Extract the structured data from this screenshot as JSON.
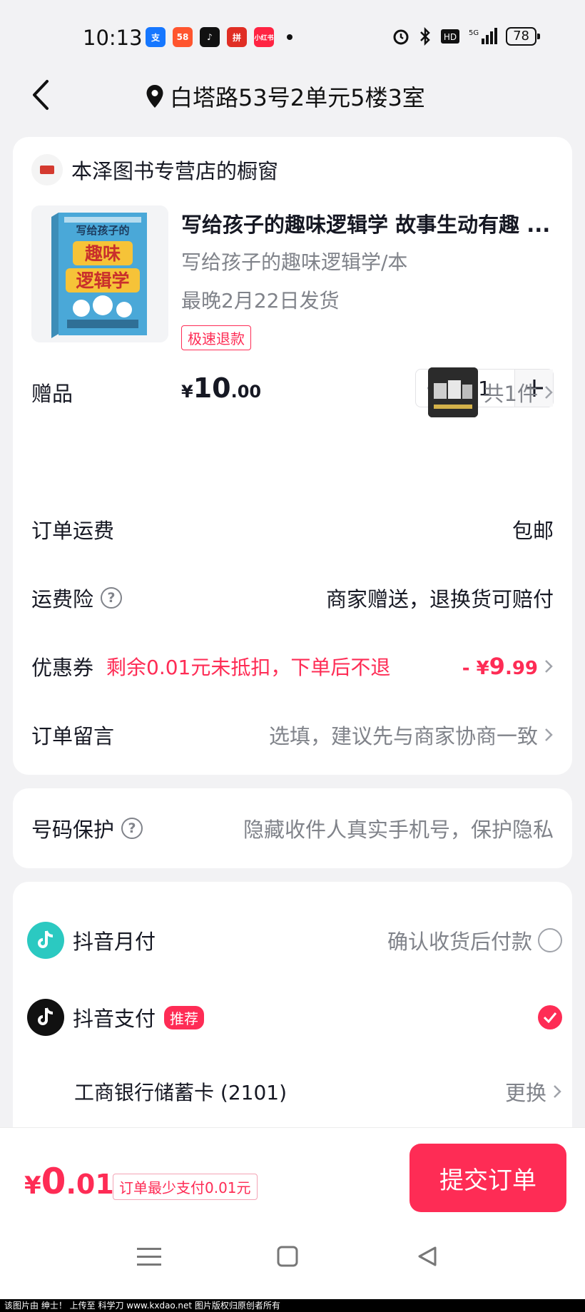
{
  "status_bar": {
    "time": "10:13",
    "battery": "78",
    "apps": [
      {
        "name": "alipay-icon",
        "text": "支",
        "color": "#1677ff"
      },
      {
        "name": "58-icon",
        "text": "58",
        "color": "#ff552e"
      },
      {
        "name": "tiktok-icon",
        "text": "♪",
        "color": "#111111"
      },
      {
        "name": "duoduo-icon",
        "text": "拼",
        "color": "#e02e24"
      },
      {
        "name": "xiaohongshu-icon",
        "text": "小红书",
        "color": "#ff2442"
      }
    ]
  },
  "nav": {
    "address": "白塔路53号2单元5楼3室"
  },
  "store": {
    "name": "本泽图书专营店的橱窗"
  },
  "product": {
    "title": "写给孩子的趣味逻辑学 故事生动有趣 ...",
    "spec": "写给孩子的趣味逻辑学/本",
    "shipping": "最晚2月22日发货",
    "tag": "极速退款",
    "price_symbol": "¥",
    "price_int": "10",
    "price_dec": ".00",
    "quantity": "1",
    "book_cover_title_1": "写给孩子的",
    "book_cover_title_2": "趣味",
    "book_cover_title_3": "逻辑学"
  },
  "rows": {
    "gift_label": "赠品",
    "gift_value": "共1件",
    "freight_label": "订单运费",
    "freight_value": "包邮",
    "insurance_label": "运费险",
    "insurance_value": "商家赠送，退换货可赔付",
    "coupon_label": "优惠券",
    "coupon_note": "剩余0.01元未抵扣，下单后不退",
    "coupon_prefix": "- ¥",
    "coupon_int": "9",
    "coupon_dec": ".99",
    "message_label": "订单留言",
    "message_value": "选填，建议先与商家协商一致"
  },
  "privacy": {
    "label": "号码保护",
    "value": "隐藏收件人真实手机号，保护隐私"
  },
  "payment": {
    "monthly_label": "抖音月付",
    "monthly_note": "确认收货后付款",
    "douyin_label": "抖音支付",
    "recommend_badge": "推荐",
    "bank_card": "工商银行储蓄卡 (2101)",
    "change_label": "更换"
  },
  "bottom": {
    "total_symbol": "¥",
    "total_int": "0",
    "total_dec": ".01",
    "min_note": "订单最少支付0.01元",
    "submit_label": "提交订单"
  },
  "watermark": "该图片由 绅士！ 上传至 科学刀 www.kxdao.net 图片版权归原创者所有",
  "colors": {
    "accent": "#fe2c55",
    "text": "#161823",
    "muted": "#80838a"
  }
}
